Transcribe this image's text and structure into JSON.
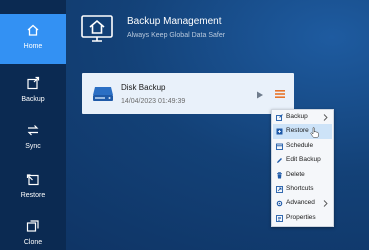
{
  "sidebar": {
    "items": [
      {
        "label": "Home",
        "icon": "home-icon",
        "active": true
      },
      {
        "label": "Backup",
        "icon": "backup-icon",
        "active": false
      },
      {
        "label": "Sync",
        "icon": "sync-icon",
        "active": false
      },
      {
        "label": "Restore",
        "icon": "restore-icon",
        "active": false
      },
      {
        "label": "Clone",
        "icon": "clone-icon",
        "active": false
      }
    ]
  },
  "header": {
    "title": "Backup Management",
    "subtitle": "Always Keep Global Data Safer",
    "icon": "monitor-home-icon"
  },
  "backup_task": {
    "name": "Disk Backup",
    "date": "14/04/2023 01:49:39",
    "icon": "disk-icon"
  },
  "context_menu": {
    "items": [
      {
        "label": "Backup",
        "icon": "backup-icon",
        "submenu": true
      },
      {
        "label": "Restore",
        "icon": "restore-icon",
        "submenu": false,
        "highlighted": true
      },
      {
        "label": "Schedule",
        "icon": "schedule-icon",
        "submenu": false
      },
      {
        "label": "Edit Backup",
        "icon": "edit-icon",
        "submenu": false
      },
      {
        "label": "Delete",
        "icon": "delete-icon",
        "submenu": false
      },
      {
        "label": "Shortcuts",
        "icon": "shortcut-icon",
        "submenu": false
      },
      {
        "label": "Advanced",
        "icon": "advanced-icon",
        "submenu": true
      },
      {
        "label": "Properties",
        "icon": "properties-icon",
        "submenu": false
      }
    ]
  },
  "colors": {
    "accent": "#3391f3",
    "sidebar": "#0b2a52",
    "menu_icon_orange": "#e8742a",
    "highlight": "#cde3f8"
  }
}
